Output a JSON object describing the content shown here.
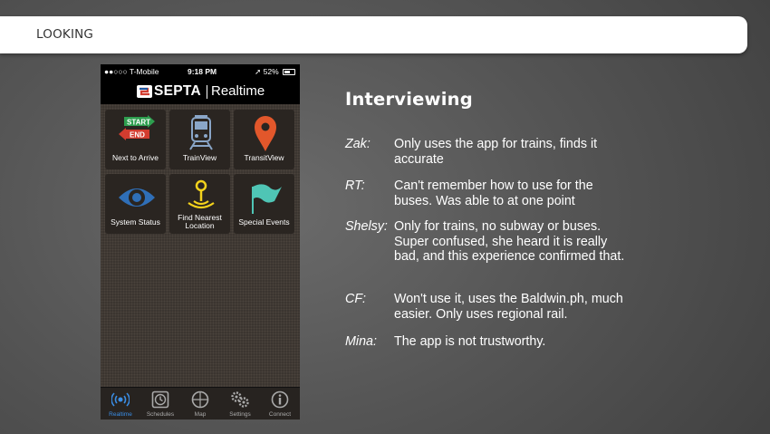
{
  "slide": {
    "section_title": "LOOKING"
  },
  "phone": {
    "status_bar": {
      "carrier": "●●○○○ T-Mobile",
      "time": "9:18 PM",
      "battery": "52%"
    },
    "header": {
      "brand": "SEPTA",
      "subtitle": "Realtime"
    },
    "tiles": [
      {
        "label": "Next to Arrive",
        "icon": "start-end-arrows-icon",
        "badge_top": "START",
        "badge_bottom": "END"
      },
      {
        "label": "TrainView",
        "icon": "train-icon"
      },
      {
        "label": "TransitView",
        "icon": "map-pin-icon"
      },
      {
        "label": "System Status",
        "icon": "eye-icon"
      },
      {
        "label": "Find Nearest Location",
        "icon": "location-signal-icon"
      },
      {
        "label": "Special Events",
        "icon": "flag-icon"
      }
    ],
    "tabs": [
      {
        "label": "Realtime",
        "icon": "broadcast-icon",
        "active": true
      },
      {
        "label": "Schedules",
        "icon": "clock-icon",
        "active": false
      },
      {
        "label": "Map",
        "icon": "compass-icon",
        "active": false
      },
      {
        "label": "Settings",
        "icon": "gears-icon",
        "active": false
      },
      {
        "label": "Connect",
        "icon": "info-icon",
        "active": false
      }
    ],
    "colors": {
      "accent_blue": "#3a8ee6",
      "pin_orange": "#e2572b",
      "flag_teal": "#4fc5b5",
      "eye_blue": "#2f6fb8",
      "start_green": "#2e9e4f",
      "end_red": "#d33c2f",
      "find_yellow": "#f3d21c"
    }
  },
  "interviews": {
    "heading": "Interviewing",
    "entries": [
      {
        "speaker": "Zak:",
        "quote": "Only uses the app for trains, finds it accurate"
      },
      {
        "speaker": "RT:",
        "quote": "Can't remember how to use for the buses. Was able to at one point"
      },
      {
        "speaker": "Shelsy:",
        "quote": "Only for trains, no subway or buses. Super confused, she heard it is really bad, and this experience confirmed that."
      },
      {
        "speaker": "CF:",
        "quote": "Won't use it, uses the Baldwin.ph, much easier. Only uses regional rail."
      },
      {
        "speaker": "Mina:",
        "quote": "The app is not trustworthy."
      }
    ]
  }
}
